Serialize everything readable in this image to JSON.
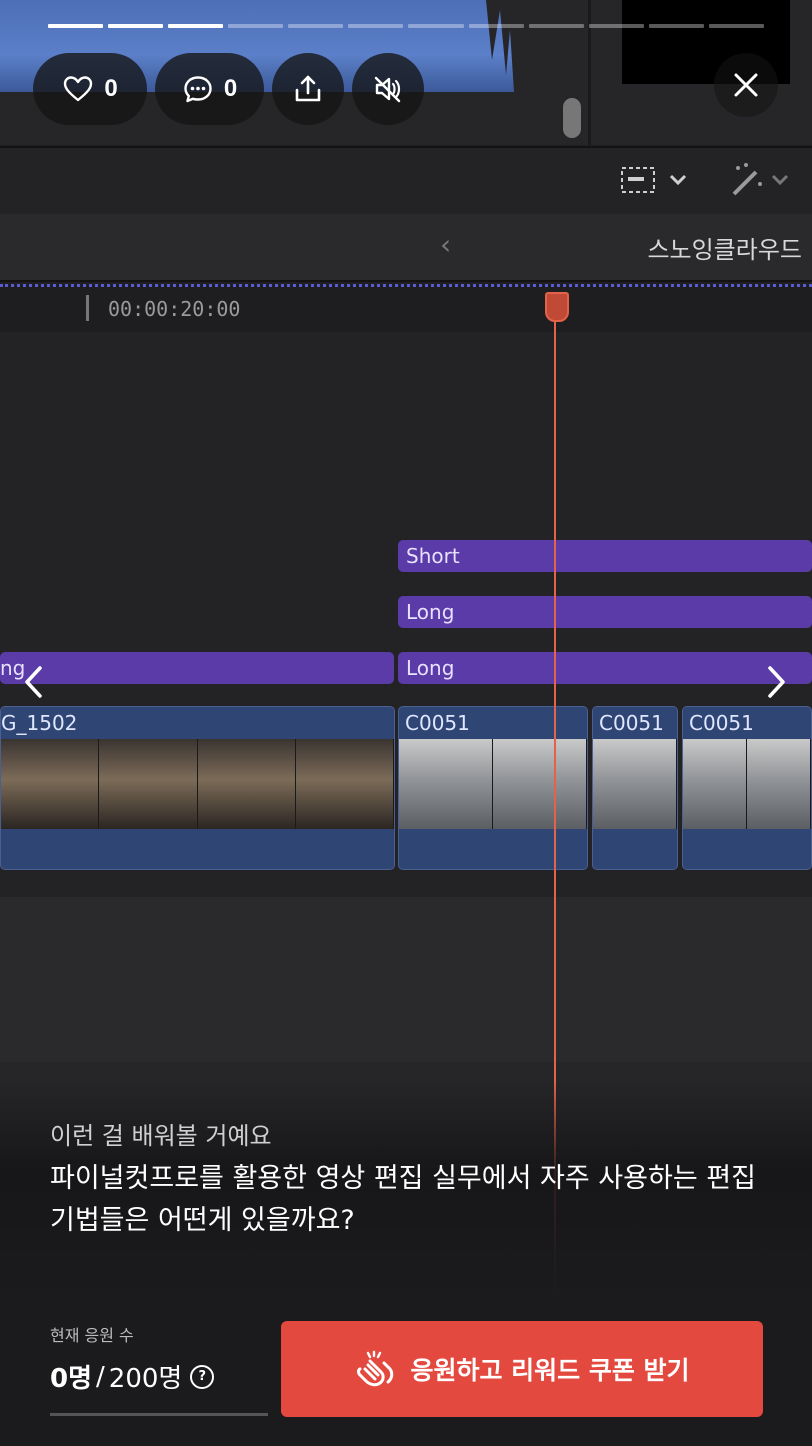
{
  "progress": {
    "total_segments": 12,
    "active_segments": 3
  },
  "actions": {
    "like_count": "0",
    "comment_count": "0"
  },
  "video_scene": {
    "path_title": "스노잉클라우드",
    "timecode": "00:00:20:00",
    "clips": {
      "short": "Short",
      "long_a": "Long",
      "long_b": "Long",
      "long_left": "ng",
      "video_left": "G_1502",
      "video_1": "C0051",
      "video_2": "C0051",
      "video_3": "C0051"
    }
  },
  "caption": {
    "subtitle": "이런 걸 배워볼 거예요",
    "title": "파이널컷프로를 활용한 영상 편집 실무에서 자주 사용하는 편집 기법들은 어떤게 있을까요?"
  },
  "cheer": {
    "label": "현재 응원 수",
    "current": "0명",
    "separator": "/",
    "goal": "200명",
    "help_glyph": "?",
    "progress_fraction": 0
  },
  "cta": {
    "label": "응원하고 리워드 쿠폰 받기"
  },
  "colors": {
    "cta": "#e4493f",
    "playhead": "#e2634a",
    "clip_purple": "#5b3ba8",
    "clip_video": "#2f4573"
  }
}
